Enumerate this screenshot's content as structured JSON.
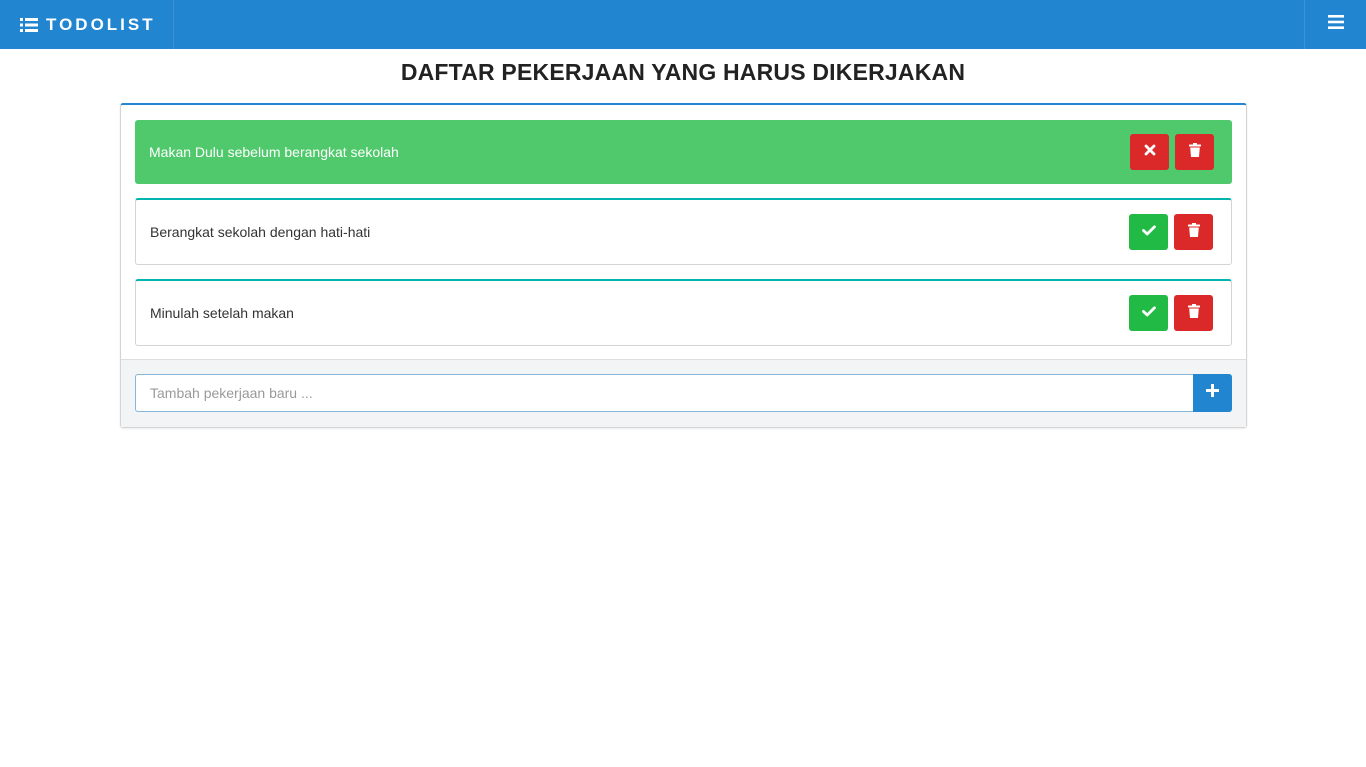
{
  "navbar": {
    "brand_icon": "list-icon",
    "brand_text": "TODOLIST",
    "menu_icon": "hamburger-menu-icon",
    "background": "#2185d0"
  },
  "page": {
    "title": "DAFTAR PEKERJAAN YANG HARUS DIKERJAKAN"
  },
  "todos": [
    {
      "text": "Makan Dulu sebelum berangkat sekolah",
      "status": "done",
      "toggle_icon": "close-icon",
      "delete_icon": "trash-icon"
    },
    {
      "text": "Berangkat sekolah dengan hati-hati",
      "status": "pending",
      "toggle_icon": "checkmark-icon",
      "delete_icon": "trash-icon"
    },
    {
      "text": "Minulah setelah makan",
      "status": "pending",
      "toggle_icon": "checkmark-icon",
      "delete_icon": "trash-icon"
    }
  ],
  "new_task": {
    "placeholder": "Tambah pekerjaan baru ...",
    "value": "",
    "add_icon": "plus-icon"
  },
  "colors": {
    "primary": "#2185d0",
    "done_bg": "#4fc96b",
    "success": "#21ba45",
    "danger": "#db2828",
    "pending_accent": "#00b5ad"
  }
}
